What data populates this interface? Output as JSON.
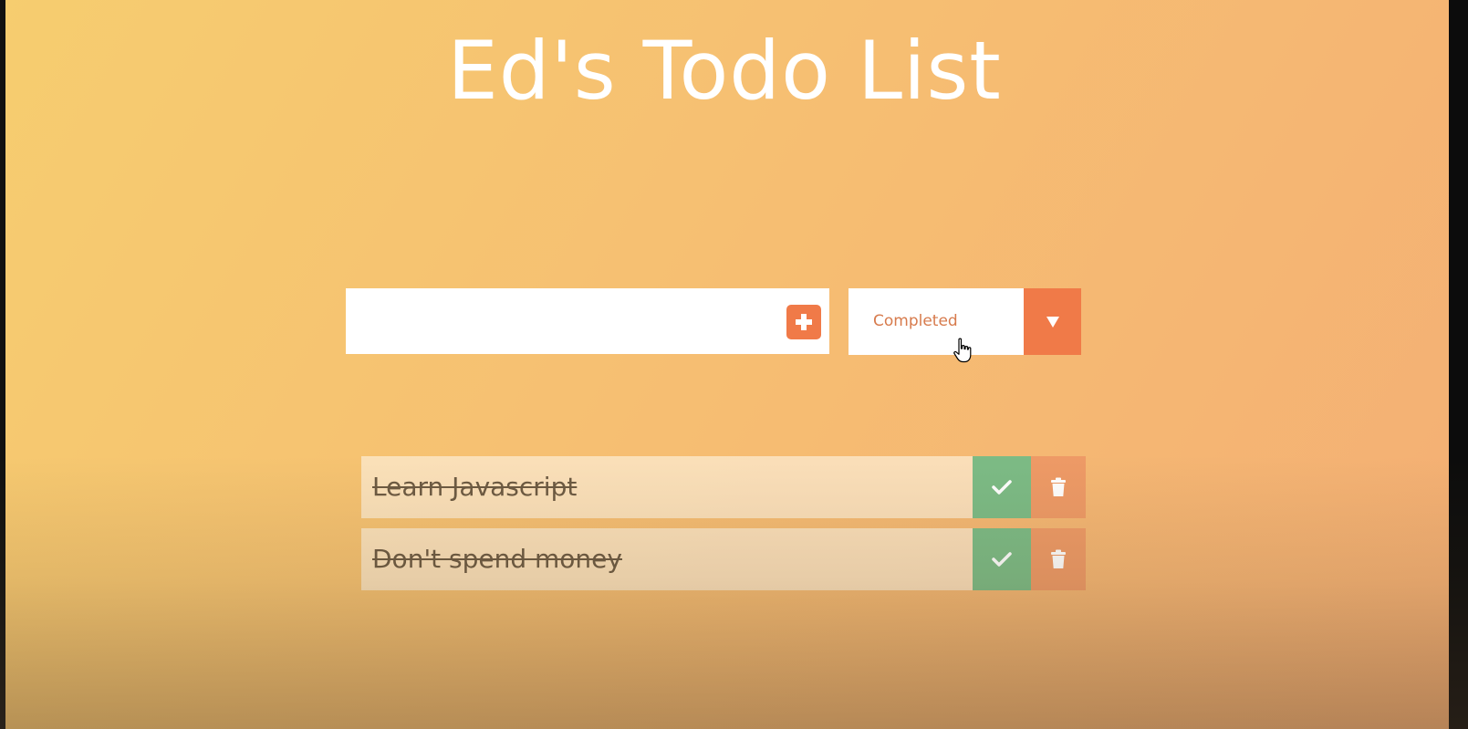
{
  "app": {
    "title": "Ed's Todo List"
  },
  "form": {
    "input_value": "",
    "input_placeholder": "",
    "add_icon": "plus-square-icon",
    "filter": {
      "selected": "Completed",
      "arrow_icon": "caret-down-icon"
    }
  },
  "todos": [
    {
      "text": "Learn Javascript",
      "completed": true
    },
    {
      "text": "Don't spend money",
      "completed": true
    }
  ],
  "colors": {
    "accent": "#f07a48",
    "complete": "#7cbb85",
    "trash": "#ee9a66",
    "filter_text": "#d77b4d"
  }
}
